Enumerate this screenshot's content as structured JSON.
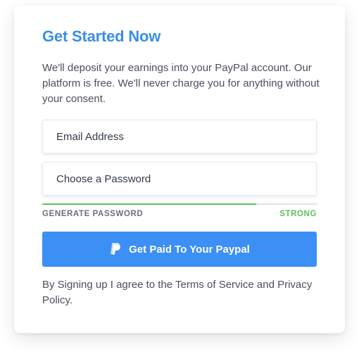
{
  "signup": {
    "title": "Get Started Now",
    "description": "We'll deposit your earnings into your PayPal account. Our platform is free. We'll never charge you for anything without your consent.",
    "email_placeholder": "Email Address",
    "password_placeholder": "Choose a Password",
    "generate_password_label": "GENERATE PASSWORD",
    "strength_label": "STRONG",
    "strength_fraction": 0.78,
    "submit_label": "Get Paid To Your Paypal",
    "submit_icon": "paypal-icon",
    "terms_text": "By Signing up I agree to the Terms of Service and Privacy Policy."
  },
  "colors": {
    "accent": "#3a8ee6",
    "button": "#3b8ff5",
    "strength": "#5cc15a",
    "text": "#4a4f5c"
  }
}
